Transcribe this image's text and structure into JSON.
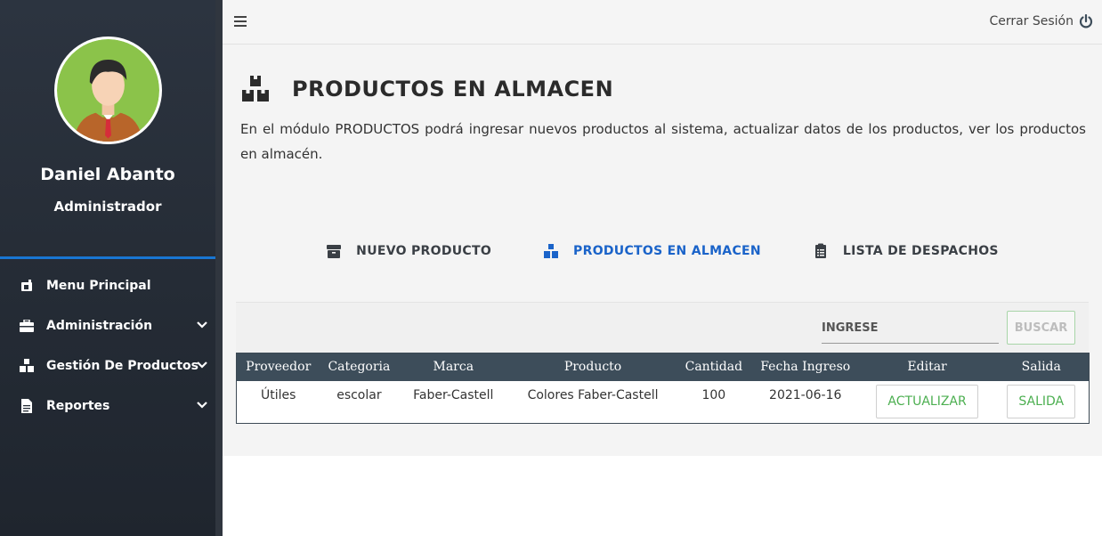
{
  "sidebar": {
    "user": {
      "name": "Daniel Abanto",
      "role": "Administrador"
    },
    "menu": [
      {
        "label": "Menu Principal",
        "icon": "dashboard-icon",
        "has_children": false
      },
      {
        "label": "Administración",
        "icon": "briefcase-icon",
        "has_children": true
      },
      {
        "label": "Gestión De Productos",
        "icon": "boxes-icon",
        "has_children": true
      },
      {
        "label": "Reportes",
        "icon": "file-icon",
        "has_children": true
      }
    ]
  },
  "topbar": {
    "logout_label": "Cerrar Sesión"
  },
  "page": {
    "title": "PRODUCTOS EN ALMACEN",
    "description": "En el módulo PRODUCTOS podrá ingresar nuevos productos al sistema, actualizar datos de los productos, ver los productos en almacén."
  },
  "tabs": [
    {
      "label": "NUEVO PRODUCTO",
      "icon": "box-icon",
      "active": false
    },
    {
      "label": "PRODUCTOS EN ALMACEN",
      "icon": "boxes-icon",
      "active": true
    },
    {
      "label": "LISTA DE DESPACHOS",
      "icon": "clipboard-list-icon",
      "active": false
    }
  ],
  "search": {
    "placeholder": "INGRESE",
    "button_label": "BUSCAR"
  },
  "table": {
    "headers": [
      "Proveedor",
      "Categoria",
      "Marca",
      "Producto",
      "Cantidad",
      "Fecha Ingreso",
      "Editar",
      "Salida"
    ],
    "rows": [
      {
        "proveedor": "Útiles",
        "categoria": "escolar",
        "marca": "Faber-Castell",
        "producto": "Colores Faber-Castell",
        "cantidad": "100",
        "fecha": "2021-06-16",
        "editar": "ACTUALIZAR",
        "salida": "SALIDA"
      }
    ]
  },
  "colors": {
    "sidebar_bg": "#262d37",
    "accent_blue": "#1a63c9",
    "success_green": "#4caf50",
    "table_header": "#3d4d5a"
  }
}
